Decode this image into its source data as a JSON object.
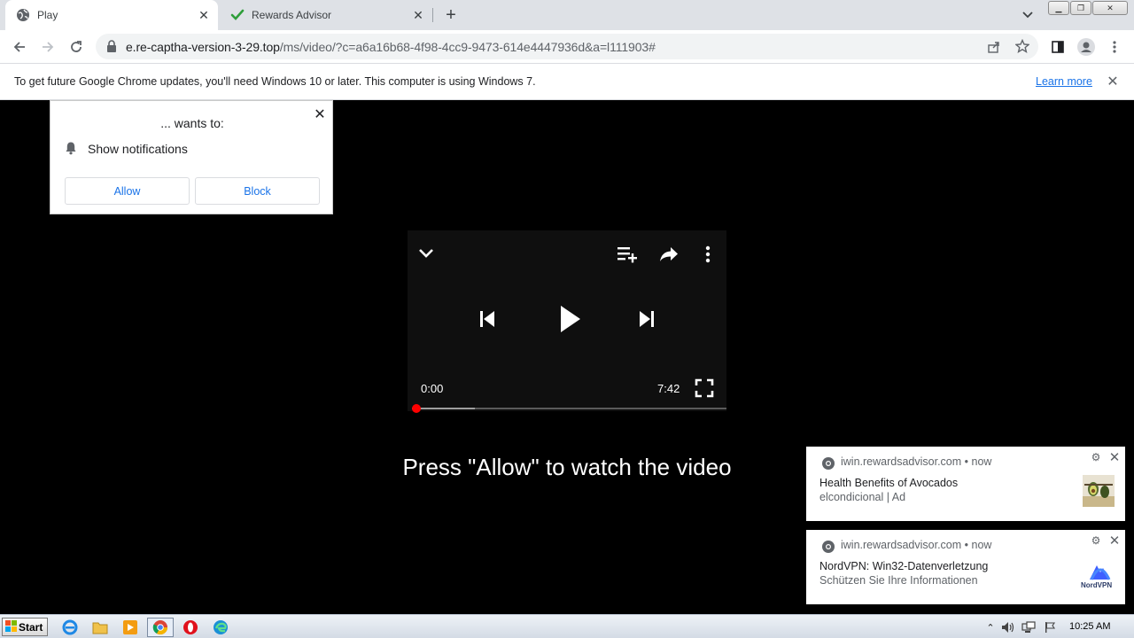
{
  "browser": {
    "tabs": [
      {
        "title": "Play",
        "active": true
      },
      {
        "title": "Rewards Advisor",
        "active": false
      }
    ],
    "new_tab_label": "+",
    "url_host": "e.re-captha-version-3-29.top",
    "url_rest": "/ms/video/?c=a6a16b68-4f98-4cc9-9473-614e4447936d&a=l111903#"
  },
  "infobar": {
    "message": "To get future Google Chrome updates, you'll need Windows 10 or later. This computer is using Windows 7.",
    "link": "Learn more"
  },
  "permission_popup": {
    "title": "... wants to:",
    "permission": "Show notifications",
    "allow_label": "Allow",
    "block_label": "Block"
  },
  "player": {
    "current_time": "0:00",
    "duration": "7:42",
    "progress_fraction": 0.0,
    "buffered_fraction": 0.2
  },
  "prompt": "Press \"Allow\" to watch the video",
  "notifications": [
    {
      "source": "iwin.rewardsadvisor.com",
      "time": "now",
      "title": "Health Benefits of Avocados",
      "body": "elcondicional | Ad",
      "thumbnail": "avocado-thumbnail"
    },
    {
      "source": "iwin.rewardsadvisor.com",
      "time": "now",
      "title": "NordVPN: Win32-Datenverletzung",
      "body": "Schützen Sie Ihre Informationen",
      "thumbnail": "nordvpn-logo",
      "logo_text": "NordVPN"
    }
  ],
  "taskbar": {
    "start_label": "Start",
    "clock": "10:25 AM"
  },
  "colors": {
    "accent_blue": "#1a73e8",
    "progress_red": "#ff0000",
    "player_bg": "#0f0f0f"
  }
}
